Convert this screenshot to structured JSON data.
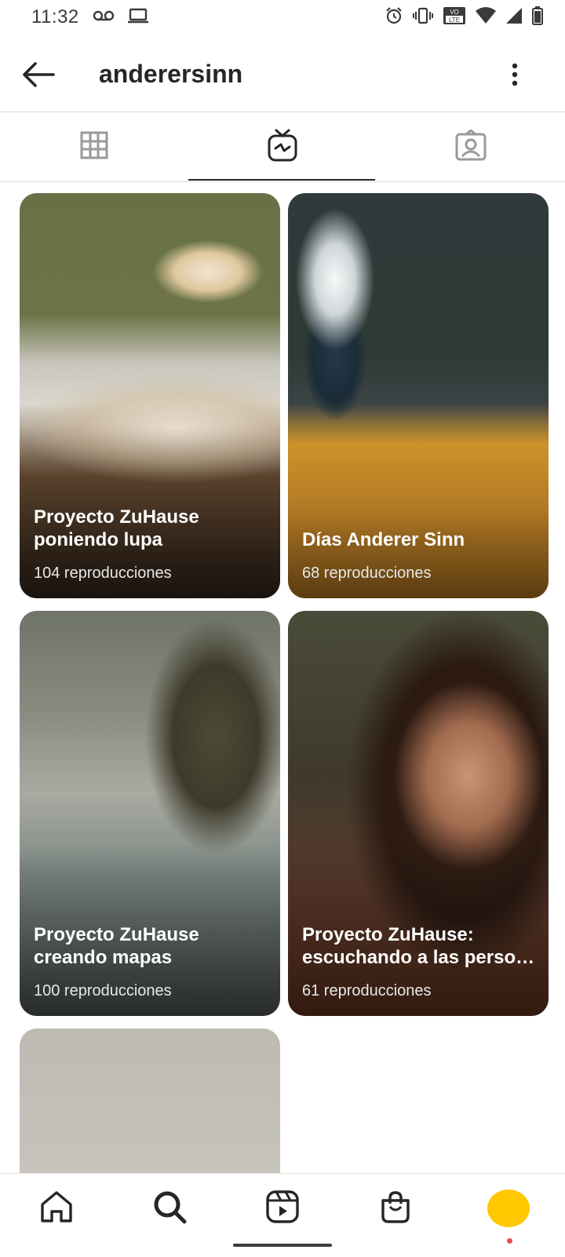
{
  "status_bar": {
    "time": "11:32",
    "left_icons": [
      "voicemail-icon",
      "laptop-icon"
    ],
    "right_icons": [
      "alarm-icon",
      "vibrate-icon",
      "volte-icon",
      "wifi-icon",
      "signal-icon",
      "battery-icon"
    ],
    "volte_label_top": "VO",
    "volte_label_bottom": "LTE"
  },
  "header": {
    "username": "anderersinn",
    "back_icon": "arrow-left-icon",
    "more_icon": "more-vertical-icon"
  },
  "tabs": [
    {
      "name": "grid",
      "icon": "grid-icon",
      "selected": false
    },
    {
      "name": "igtv",
      "icon": "igtv-icon",
      "selected": true
    },
    {
      "name": "tagged",
      "icon": "tagged-icon",
      "selected": false
    }
  ],
  "videos": [
    {
      "title_line1": "Proyecto ZuHause",
      "title_line2": "poniendo lupa",
      "views": "104 reproducciones"
    },
    {
      "title_line1": "Días Anderer Sinn",
      "title_line2": "",
      "views": "68 reproducciones"
    },
    {
      "title_line1": "Proyecto ZuHause",
      "title_line2": "creando mapas",
      "views": "100 reproducciones"
    },
    {
      "title_line1": "Proyecto ZuHause:",
      "title_line2": "escuchando a las person…",
      "views": "61 reproducciones"
    }
  ],
  "bottom_nav": [
    {
      "name": "home",
      "icon": "home-icon"
    },
    {
      "name": "search",
      "icon": "search-icon",
      "selected": true
    },
    {
      "name": "reels",
      "icon": "reels-icon"
    },
    {
      "name": "shop",
      "icon": "shopping-bag-icon"
    },
    {
      "name": "profile",
      "icon": "avatar"
    }
  ],
  "colors": {
    "avatar": "#ffc800",
    "notification_dot": "#ed4956",
    "active_underline": "#262626"
  }
}
